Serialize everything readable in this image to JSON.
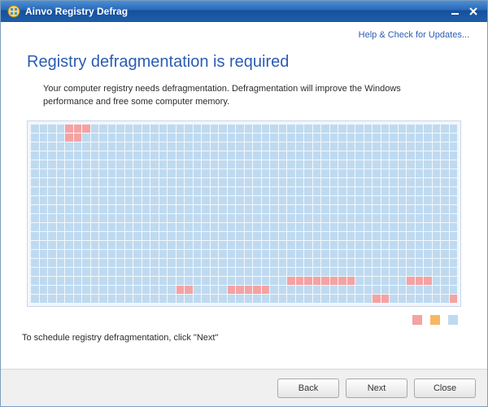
{
  "window": {
    "title": "Ainvo Registry Defrag"
  },
  "header": {
    "help_link": "Help & Check for Updates..."
  },
  "main": {
    "heading": "Registry defragmentation is required",
    "description": "Your computer registry needs defragmentation. Defragmentation will improve the Windows performance and free some computer memory.",
    "schedule_hint": "To schedule registry defragmentation, click \"Next\""
  },
  "grid": {
    "cols": 50,
    "rows": 20,
    "fragmented_cells": [
      [
        0,
        4
      ],
      [
        0,
        5
      ],
      [
        0,
        6
      ],
      [
        1,
        4
      ],
      [
        1,
        5
      ],
      [
        17,
        30
      ],
      [
        17,
        31
      ],
      [
        17,
        32
      ],
      [
        17,
        33
      ],
      [
        17,
        34
      ],
      [
        17,
        35
      ],
      [
        17,
        36
      ],
      [
        17,
        37
      ],
      [
        17,
        44
      ],
      [
        17,
        45
      ],
      [
        17,
        46
      ],
      [
        18,
        17
      ],
      [
        18,
        18
      ],
      [
        18,
        23
      ],
      [
        18,
        24
      ],
      [
        18,
        25
      ],
      [
        18,
        26
      ],
      [
        18,
        27
      ],
      [
        19,
        40
      ],
      [
        19,
        41
      ],
      [
        19,
        49
      ]
    ]
  },
  "legend": {
    "colors": {
      "fragmented": "#f5a2a2",
      "compacted": "#f7b863",
      "free": "#bfdaf0"
    }
  },
  "buttons": {
    "back": "Back",
    "next": "Next",
    "close": "Close"
  }
}
